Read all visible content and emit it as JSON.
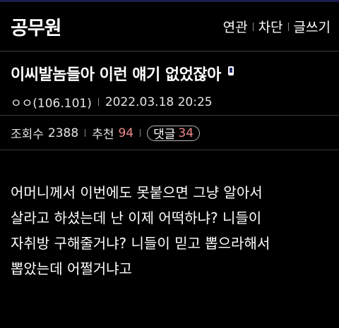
{
  "colors": {
    "background": "#000000",
    "top_accent": "#1b1d4a",
    "text": "#ffffff",
    "meta_text": "#e6e6e6",
    "divider": "#3a3a3a",
    "count_accent": "#f08a8a"
  },
  "header": {
    "gallery_title": "공무원",
    "menu": [
      {
        "label": "연관"
      },
      {
        "label": "차단"
      },
      {
        "label": "글쓰기"
      }
    ]
  },
  "post": {
    "title": "이씨발놈들아 이런 얘기 없었잖아",
    "title_icon": "mobile-phone-icon",
    "author": "ㅇㅇ(106.101)",
    "datetime": "2022.03.18 20:25",
    "stats": {
      "views_label": "조회수",
      "views": "2388",
      "recommend_label": "추천",
      "recommend": "94",
      "comments_label": "댓글",
      "comments": "34"
    },
    "body_lines": [
      "어머니께서 이번에도 못붙으면 그냥 알아서",
      "살라고 하셨는데 난 이제 어떡하냐? 니들이",
      "자취방 구해줄거냐? 니들이 믿고 뽑으라해서",
      "뽑았는데 어쩔거냐고"
    ]
  }
}
